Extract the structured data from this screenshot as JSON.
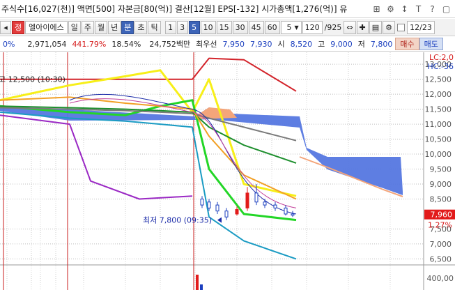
{
  "header": {
    "info_text": "주식수[16,027(천)] 액면[500] 자본금[80(억)] 결산[12월] EPS[-132] 시가총액[1,276(억)] 유",
    "icons": [
      "grid-icon",
      "gear-icon",
      "pin-icon",
      "text-icon",
      "help-icon",
      "window-icon"
    ],
    "icon_glyphs": [
      "⊞",
      "⚙",
      "↕",
      "T",
      "?",
      "▢"
    ]
  },
  "toolbar": {
    "stock_name": "엘아이에스",
    "badge": "정",
    "periods": [
      "일",
      "주",
      "월",
      "년",
      "분",
      "초",
      "틱"
    ],
    "period_selected": "분",
    "intervals": [
      "1",
      "3",
      "5",
      "10",
      "15",
      "30",
      "45",
      "60"
    ],
    "interval_selected": "5",
    "count_value": "5",
    "page_value": "120",
    "page_total": "/925",
    "date_value": "12/23"
  },
  "pricebar": {
    "pct_cut": "0%",
    "volume": "2,971,054",
    "vol_ratio": "441.79%",
    "turnover": "18.54%",
    "amount": "24,752백만",
    "best_bid_label": "최우선",
    "best_ask": "7,950",
    "best_bid": "7,930",
    "open_label": "시",
    "open": "8,520",
    "high_label": "고",
    "high": "9,000",
    "low_label": "저",
    "low": "7,800",
    "buy_label": "매수",
    "sell_label": "매도"
  },
  "chart_data": {
    "type": "line",
    "y_ticks": [
      "13,000",
      "12,500",
      "12,000",
      "11,500",
      "11,000",
      "10,500",
      "10,000",
      "9,500",
      "9,000",
      "8,500",
      "7,500",
      "7,000",
      "6,500"
    ],
    "ylim": [
      6300,
      13400
    ],
    "volume_tick": "400,00",
    "lc_label": "LC:2,0",
    "hc_label": "HC:-36",
    "current_price": "7,960",
    "current_change": "1.27%",
    "high_annotation": "고 12,500 (10:30)",
    "low_annotation": "최저 7,800 (09:35)",
    "colors": {
      "red_band": "#d3232a",
      "yellow": "#f7ef18",
      "green_bright": "#23d627",
      "purple": "#9a28c4",
      "teal": "#1a9bc3",
      "gray": "#7a7a7a",
      "dark_green": "#1e8f2e",
      "orange": "#f2a026",
      "cloud_blue": "#5577e0",
      "cloud_orange": "#f4a57a",
      "navy": "#1a2aa8"
    },
    "series": [
      {
        "values": [
          12500,
          12500,
          12500,
          12500,
          12500,
          13200,
          13150,
          12100
        ]
      },
      {
        "values": [
          11800,
          12300,
          12600,
          12800,
          11400,
          12500,
          9000,
          8600
        ]
      },
      {
        "values": [
          11600,
          11400,
          11300,
          11600,
          11800,
          9500,
          8000,
          7800
        ]
      },
      {
        "values": [
          11300,
          11000,
          9100,
          8500,
          8600
        ]
      },
      {
        "values": [
          11400,
          11200,
          11100,
          11000,
          10900,
          7900,
          7100,
          6500
        ]
      },
      {
        "values": [
          11550,
          11500,
          11450,
          11400,
          11350,
          11200,
          10900,
          10450
        ]
      },
      {
        "values": [
          11600,
          11550,
          11500,
          11450,
          11400,
          10900,
          10300,
          9700
        ]
      },
      {
        "values": [
          11800,
          11900,
          11700,
          11600,
          11500,
          10600,
          9300,
          8500
        ]
      }
    ]
  }
}
